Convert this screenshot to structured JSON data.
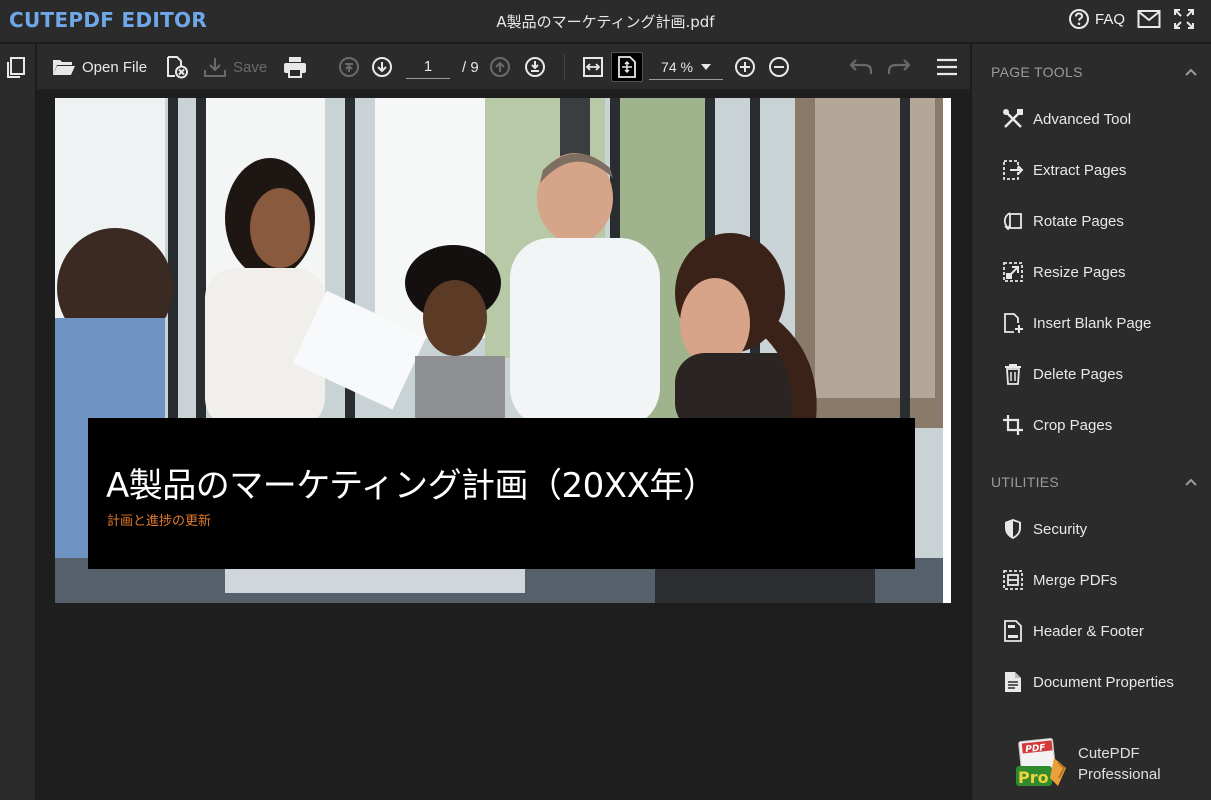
{
  "app": {
    "logo": "CUTEPDF EDITOR",
    "document_title": "A製品のマーケティング計画.pdf",
    "faq_label": "FAQ"
  },
  "toolbar": {
    "open_label": "Open File",
    "save_label": "Save",
    "current_page": "1",
    "total_pages": "/ 9",
    "zoom": "74 %"
  },
  "document": {
    "title": "A製品のマーケティング計画（20XX年）",
    "subtitle": "計画と進捗の更新"
  },
  "sidebar": {
    "page_tools_heading": "PAGE TOOLS",
    "page_tools": [
      {
        "label": "Advanced Tool",
        "icon": "tools-icon"
      },
      {
        "label": "Extract Pages",
        "icon": "extract-icon"
      },
      {
        "label": "Rotate Pages",
        "icon": "rotate-icon"
      },
      {
        "label": "Resize Pages",
        "icon": "resize-icon"
      },
      {
        "label": "Insert Blank Page",
        "icon": "insert-page-icon"
      },
      {
        "label": "Delete Pages",
        "icon": "trash-icon"
      },
      {
        "label": "Crop Pages",
        "icon": "crop-icon"
      }
    ],
    "utilities_heading": "UTILITIES",
    "utilities": [
      {
        "label": "Security",
        "icon": "shield-icon"
      },
      {
        "label": "Merge PDFs",
        "icon": "merge-icon"
      },
      {
        "label": "Header & Footer",
        "icon": "header-footer-icon"
      },
      {
        "label": "Document Properties",
        "icon": "document-icon"
      }
    ],
    "promo_line1": "CutePDF",
    "promo_line2": "Professional",
    "promo_badge_top": "PDF",
    "promo_badge_bottom": "Pro"
  },
  "colors": {
    "logo": "#6fa8e8",
    "panel": "#2b2b2b",
    "background": "#1e1e1e",
    "subtitle_accent": "#e07a2e"
  }
}
